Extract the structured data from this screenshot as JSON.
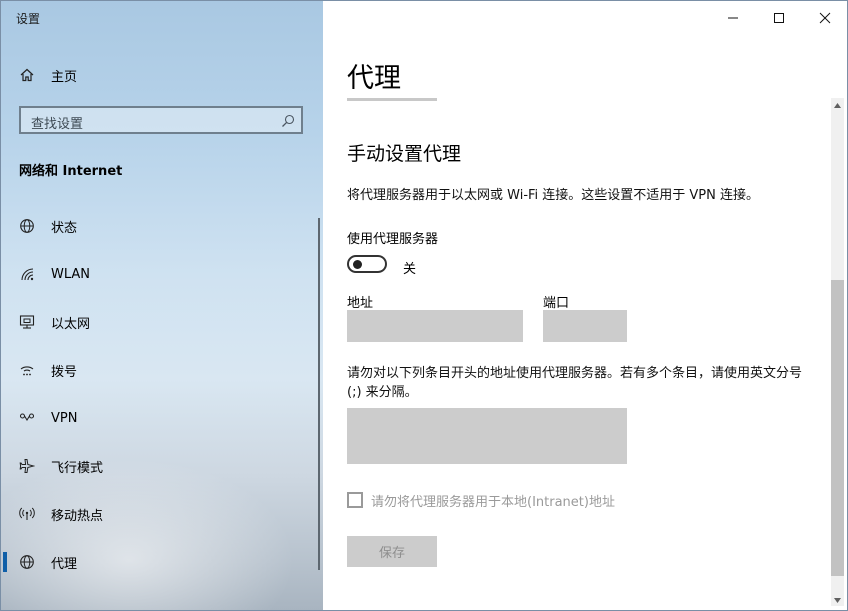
{
  "window": {
    "app_title": "设置"
  },
  "sidebar": {
    "home_label": "主页",
    "search_placeholder": "查找设置",
    "group_title": "网络和 Internet",
    "items": [
      {
        "label": "状态",
        "icon": "globe-status-icon"
      },
      {
        "label": "WLAN",
        "icon": "wifi-icon"
      },
      {
        "label": "以太网",
        "icon": "ethernet-icon"
      },
      {
        "label": "拨号",
        "icon": "dialup-icon"
      },
      {
        "label": "VPN",
        "icon": "vpn-icon"
      },
      {
        "label": "飞行模式",
        "icon": "airplane-icon"
      },
      {
        "label": "移动热点",
        "icon": "hotspot-icon"
      },
      {
        "label": "代理",
        "icon": "globe-icon",
        "active": true
      }
    ]
  },
  "main": {
    "page_title": "代理",
    "section_title": "手动设置代理",
    "description": "将代理服务器用于以太网或 Wi-Fi 连接。这些设置不适用于 VPN 连接。",
    "use_proxy_label": "使用代理服务器",
    "toggle_state": "关",
    "address_label": "地址",
    "port_label": "端口",
    "address_value": "",
    "port_value": "",
    "exceptions_description": "请勿对以下列条目开头的地址使用代理服务器。若有多个条目，请使用英文分号 (;) 来分隔。",
    "exceptions_value": "",
    "local_checkbox_label": "请勿将代理服务器用于本地(Intranet)地址",
    "save_label": "保存"
  },
  "colors": {
    "accent": "#0f5fa8",
    "input_bg": "#cccccc",
    "disabled_text": "#9a9a9a"
  }
}
